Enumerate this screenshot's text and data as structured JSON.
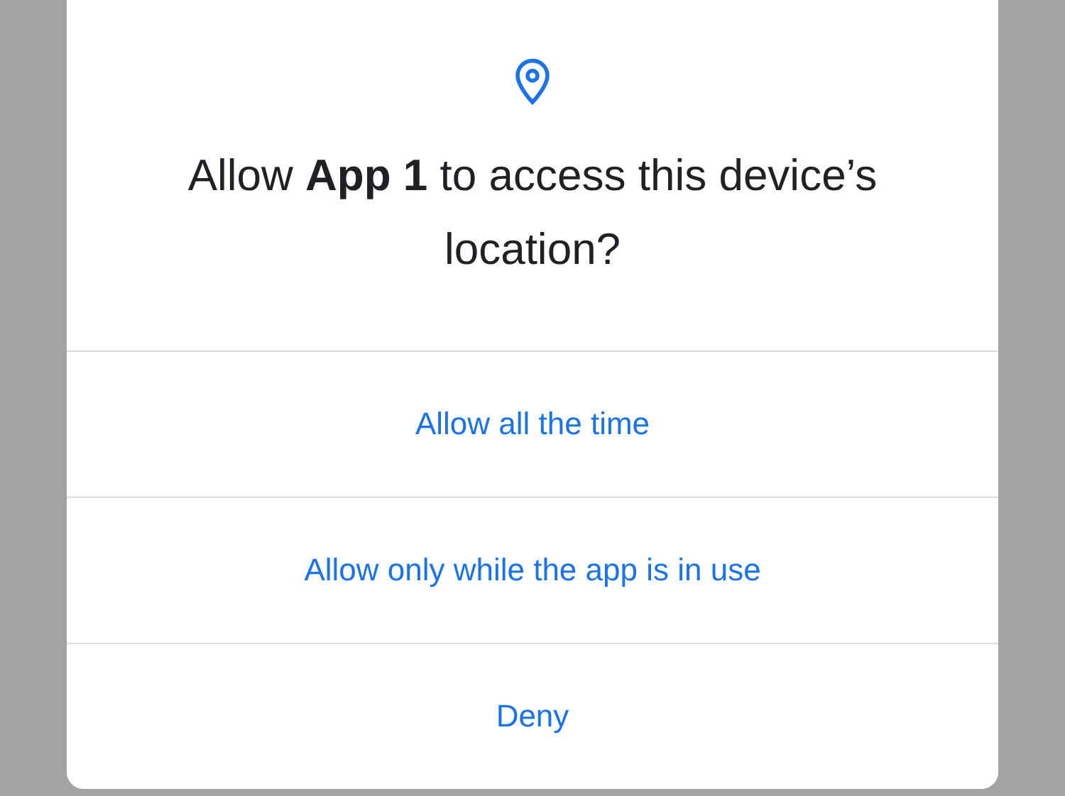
{
  "dialog": {
    "title": "Allow **App 1** to access this device’s location?",
    "options": [
      {
        "label": "Allow all the time"
      },
      {
        "label": "Allow only while the app is in use"
      },
      {
        "label": "Deny"
      }
    ]
  }
}
